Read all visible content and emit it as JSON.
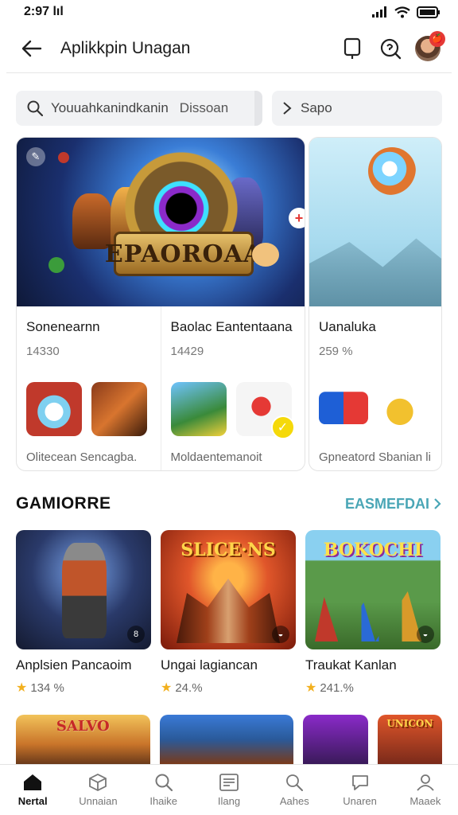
{
  "status_bar": {
    "time": "2:97 lıl"
  },
  "header": {
    "title": "Aplikkpin Unagan",
    "notification_badge": "🍎"
  },
  "search": {
    "main_text": "Youuahkanindkanin",
    "secondary_text": "Dissoan",
    "filter_text": "Sapo"
  },
  "featured": {
    "banner_logo": "EPAOROAA",
    "columns": [
      {
        "title": "Sonenearnn",
        "meta": "14330",
        "caption": "Olitecean Sencagba."
      },
      {
        "title": "Baolac Eantentaana",
        "meta": "14429",
        "caption": "Moldaentemanoit"
      },
      {
        "title": "Uanaluka",
        "meta": "259 %",
        "caption": "Gpneatord Sbanian"
      }
    ],
    "side_caption_suffix": "li"
  },
  "section": {
    "title": "GAMIORRE",
    "link": "EASMEFDAI"
  },
  "games": [
    {
      "name": "Anplsien Pancaoim",
      "rating": "134 %"
    },
    {
      "name": "Ungai lagiancan",
      "rating": "24.%"
    },
    {
      "name": "Traukat Kanlan",
      "rating": "241.%"
    }
  ],
  "game_logos": [
    "SLICE·NS",
    "BOKOCHI",
    "SALVO",
    "UNICON"
  ],
  "bottom_nav": [
    {
      "label": "Nertal",
      "icon": "home-icon",
      "active": true
    },
    {
      "label": "Unnaian",
      "icon": "cube-icon",
      "active": false
    },
    {
      "label": "Ihaike",
      "icon": "search-icon",
      "active": false
    },
    {
      "label": "Ilang",
      "icon": "list-icon",
      "active": false
    },
    {
      "label": "Aahes",
      "icon": "doc-search-icon",
      "active": false
    },
    {
      "label": "Unaren",
      "icon": "chat-icon",
      "active": false
    },
    {
      "label": "Maaek",
      "icon": "profile-icon",
      "active": false
    }
  ],
  "colors": {
    "accent_link": "#4aa6b6",
    "star": "#f2b01e",
    "badge_red": "#e53935"
  }
}
